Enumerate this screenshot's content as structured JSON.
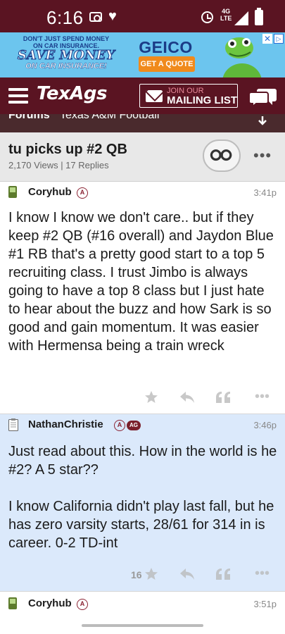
{
  "status_bar": {
    "time": "6:16",
    "network_top": "4G",
    "network_bottom": "LTE"
  },
  "ad": {
    "line1": "DON'T JUST SPEND MONEY",
    "line2": "ON CAR INSURANCE.",
    "line3": "SAVE MONEY",
    "line4": "ON CAR INSURANCE!",
    "brand": "GEICO",
    "cta": "GET A QUOTE",
    "close_label": "✕",
    "info_label": "▷"
  },
  "header": {
    "logo": "TexAgs",
    "mailing_top": "JOIN OUR",
    "mailing_bottom": "MAILING LIST"
  },
  "breadcrumb": {
    "section": "Forums",
    "subforum": "Texas A&M Football"
  },
  "thread": {
    "title": "tu picks up #2 QB",
    "meta": "2,170 Views | 17 Replies"
  },
  "posts": [
    {
      "user": "Coryhub",
      "badge": "A",
      "time": "3:41p",
      "body": "I know I know we don't care.. but if they keep #2 QB (#16 overall) and Jaydon Blue #1 RB that's a pretty good start to a top 5 recruiting class. I trust Jimbo is always going to have a top 8 class but I just hate to hear about the buzz and how Sark is so good and gain momentum. It was easier with Hermensa being a train wreck",
      "likes": ""
    },
    {
      "user": "NathanChristie",
      "badge": "A",
      "badge2": "AG",
      "time": "3:46p",
      "body": "Just read about this. How in the world is he #2? A 5 star??\n\nI know California didn't play last fall, but he has zero varsity starts, 28/61 for 314 in is career. 0-2 TD-int",
      "likes": "16"
    },
    {
      "user": "Coryhub",
      "badge": "A",
      "time": "3:51p"
    }
  ],
  "colors": {
    "brand_maroon": "#5a1422",
    "highlight_post_bg": "#dbe9fb",
    "ad_bg": "#6cc5ee"
  }
}
